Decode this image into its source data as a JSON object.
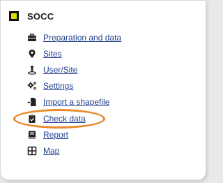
{
  "app": {
    "title": "SOCC"
  },
  "menu": [
    {
      "label": "Preparation and data",
      "icon": "toolbox-icon"
    },
    {
      "label": "Sites",
      "icon": "map-pin-icon"
    },
    {
      "label": "User/Site",
      "icon": "user-location-icon"
    },
    {
      "label": "Settings",
      "icon": "gears-icon"
    },
    {
      "label": "Import a shapefile",
      "icon": "file-import-icon"
    },
    {
      "label": "Check data",
      "icon": "clipboard-check-icon"
    },
    {
      "label": "Report",
      "icon": "book-icon"
    },
    {
      "label": "Map",
      "icon": "grid-map-icon"
    }
  ],
  "colors": {
    "logo_accent": "#d9e000",
    "link": "#1f3f8f",
    "highlight": "#e88a2c"
  }
}
